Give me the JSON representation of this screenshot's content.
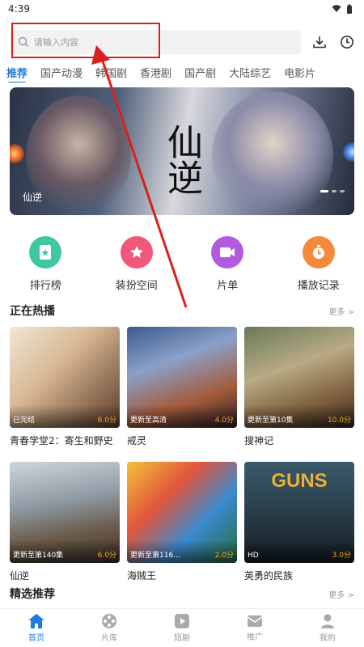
{
  "status": {
    "time": "4:39"
  },
  "search": {
    "placeholder": "请输入内容"
  },
  "tabs": [
    "推荐",
    "国产动漫",
    "韩国剧",
    "香港剧",
    "国产剧",
    "大陆综艺",
    "电影片"
  ],
  "banner": {
    "title": "仙逆",
    "calligraphy": "仙逆"
  },
  "quick_links": [
    {
      "label": "排行榜",
      "color": "#3ec7a0",
      "icon": "ranking-icon"
    },
    {
      "label": "装扮空间",
      "color": "#f0577a",
      "icon": "star-icon"
    },
    {
      "label": "片单",
      "color": "#b45ae0",
      "icon": "video-list-icon"
    },
    {
      "label": "播放记录",
      "color": "#f5893a",
      "icon": "history-icon"
    }
  ],
  "hot": {
    "title": "正在热播",
    "more": "更多 >",
    "items": [
      {
        "title": "青春学堂2：寄生和野史",
        "ep": "已完结",
        "score": "6.0分"
      },
      {
        "title": "戒灵",
        "ep": "更新至高清",
        "score": "4.0分"
      },
      {
        "title": "搜神记",
        "ep": "更新至第10集",
        "score": "10.0分"
      },
      {
        "title": "仙逆",
        "ep": "更新至第140集",
        "score": "6.0分"
      },
      {
        "title": "海贼王",
        "ep": "更新至第116...",
        "score": "2.0分"
      },
      {
        "title": "英勇的民族",
        "ep": "HD",
        "score": "3.0分",
        "poster_text": "GUNS"
      }
    ]
  },
  "featured": {
    "title": "精选推荐",
    "more": "更多 >"
  },
  "nav": [
    {
      "label": "首页",
      "icon": "home-icon",
      "active": true
    },
    {
      "label": "片库",
      "icon": "film-reel-icon"
    },
    {
      "label": "短剧",
      "icon": "play-icon"
    },
    {
      "label": "推广",
      "icon": "mail-icon"
    },
    {
      "label": "我的",
      "icon": "user-icon"
    }
  ]
}
